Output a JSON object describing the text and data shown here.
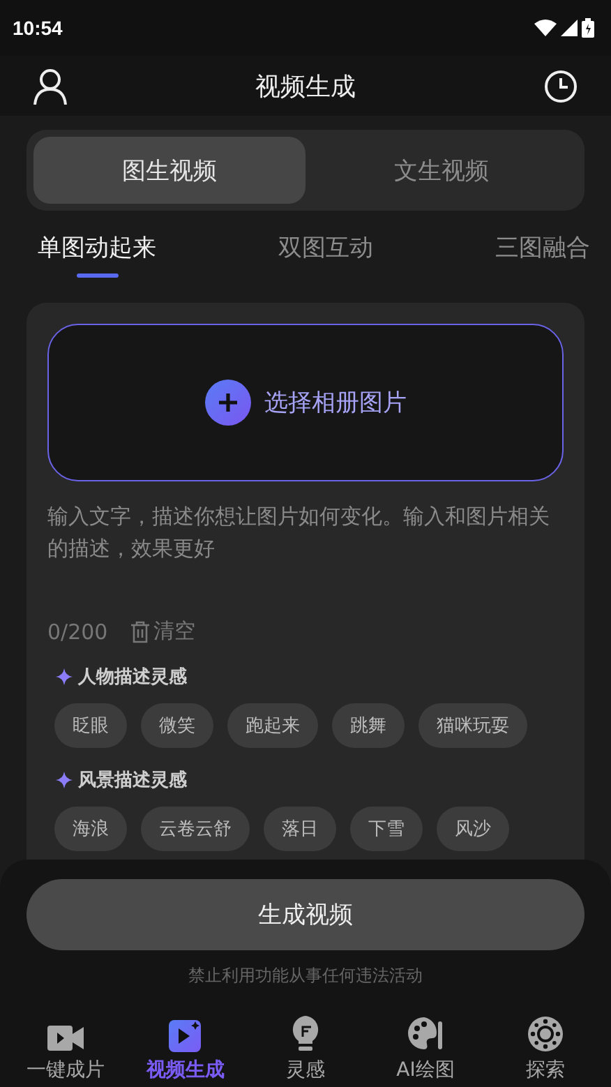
{
  "status_bar": {
    "time": "10:54"
  },
  "header": {
    "title": "视频生成"
  },
  "mode_tabs": [
    {
      "label": "图生视频",
      "selected": true
    },
    {
      "label": "文生视频",
      "selected": false
    }
  ],
  "sub_tabs": [
    {
      "label": "单图动起来",
      "selected": true
    },
    {
      "label": "双图互动",
      "selected": false
    },
    {
      "label": "三图融合",
      "selected": false
    }
  ],
  "upload": {
    "label": "选择相册图片"
  },
  "prompt": {
    "placeholder": "输入文字，描述你想让图片如何变化。输入和图片相关的描述，效果更好",
    "counter": "0/200",
    "clear_label": "清空"
  },
  "inspiration_groups": [
    {
      "title": "人物描述灵感",
      "tags": [
        "眨眼",
        "微笑",
        "跑起来",
        "跳舞",
        "猫咪玩耍"
      ]
    },
    {
      "title": "风景描述灵感",
      "tags": [
        "海浪",
        "云卷云舒",
        "落日",
        "下雪",
        "风沙"
      ]
    }
  ],
  "generate_button": "生成视频",
  "disclaimer": "禁止利用功能从事任何违法活动",
  "bottom_nav": [
    {
      "kind": "camera",
      "label": "一键成片",
      "selected": false
    },
    {
      "kind": "video",
      "label": "视频生成",
      "selected": true
    },
    {
      "kind": "bulb",
      "label": "灵感",
      "selected": false
    },
    {
      "kind": "palette",
      "label": "AI绘图",
      "selected": false
    },
    {
      "kind": "reel",
      "label": "探索",
      "selected": false
    }
  ]
}
